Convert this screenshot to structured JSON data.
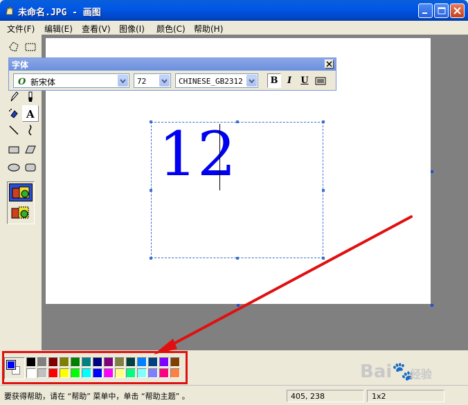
{
  "window": {
    "title": "未命名.JPG - 画图"
  },
  "menu": [
    "文件(F)",
    "编辑(E)",
    "查看(V)",
    "图像(I)",
    "颜色(C)",
    "帮助(H)"
  ],
  "font_toolbar": {
    "title": "字体",
    "font_name": "新宋体",
    "font_size": "72",
    "script": "CHINESE_GB2312",
    "bold_label": "B",
    "italic_label": "I",
    "underline_label": "U"
  },
  "canvas": {
    "typed_text": "12"
  },
  "palette": {
    "foreground": "#0000ff",
    "background": "#ffffff",
    "top_row": [
      "#000000",
      "#808080",
      "#800000",
      "#808000",
      "#008000",
      "#008080",
      "#000080",
      "#800080",
      "#808040",
      "#004040",
      "#0080ff",
      "#004080",
      "#8000ff",
      "#804000"
    ],
    "bottom_row": [
      "#ffffff",
      "#c0c0c0",
      "#ff0000",
      "#ffff00",
      "#00ff00",
      "#00ffff",
      "#0000ff",
      "#ff00ff",
      "#ffff80",
      "#00ff80",
      "#80ffff",
      "#8080ff",
      "#ff0080",
      "#ff8040"
    ]
  },
  "status": {
    "help_text": "要获得帮助，请在 “帮助” 菜单中，单击 “帮助主题” 。",
    "coords": "405, 238",
    "size": "1x2"
  },
  "watermark": {
    "main": "Bai",
    "sub": "经验"
  },
  "colors": {
    "annotation_red": "#e01010",
    "title_blue": "#0058e6"
  },
  "tools_icons": [
    "free-select-icon",
    "rect-select-icon",
    "eraser-icon",
    "fill-icon",
    "color-picker-icon",
    "magnifier-icon",
    "pencil-icon",
    "brush-icon",
    "airbrush-icon",
    "text-icon",
    "line-icon",
    "curve-icon",
    "rectangle-icon",
    "polygon-icon",
    "ellipse-icon",
    "rounded-rect-icon"
  ]
}
